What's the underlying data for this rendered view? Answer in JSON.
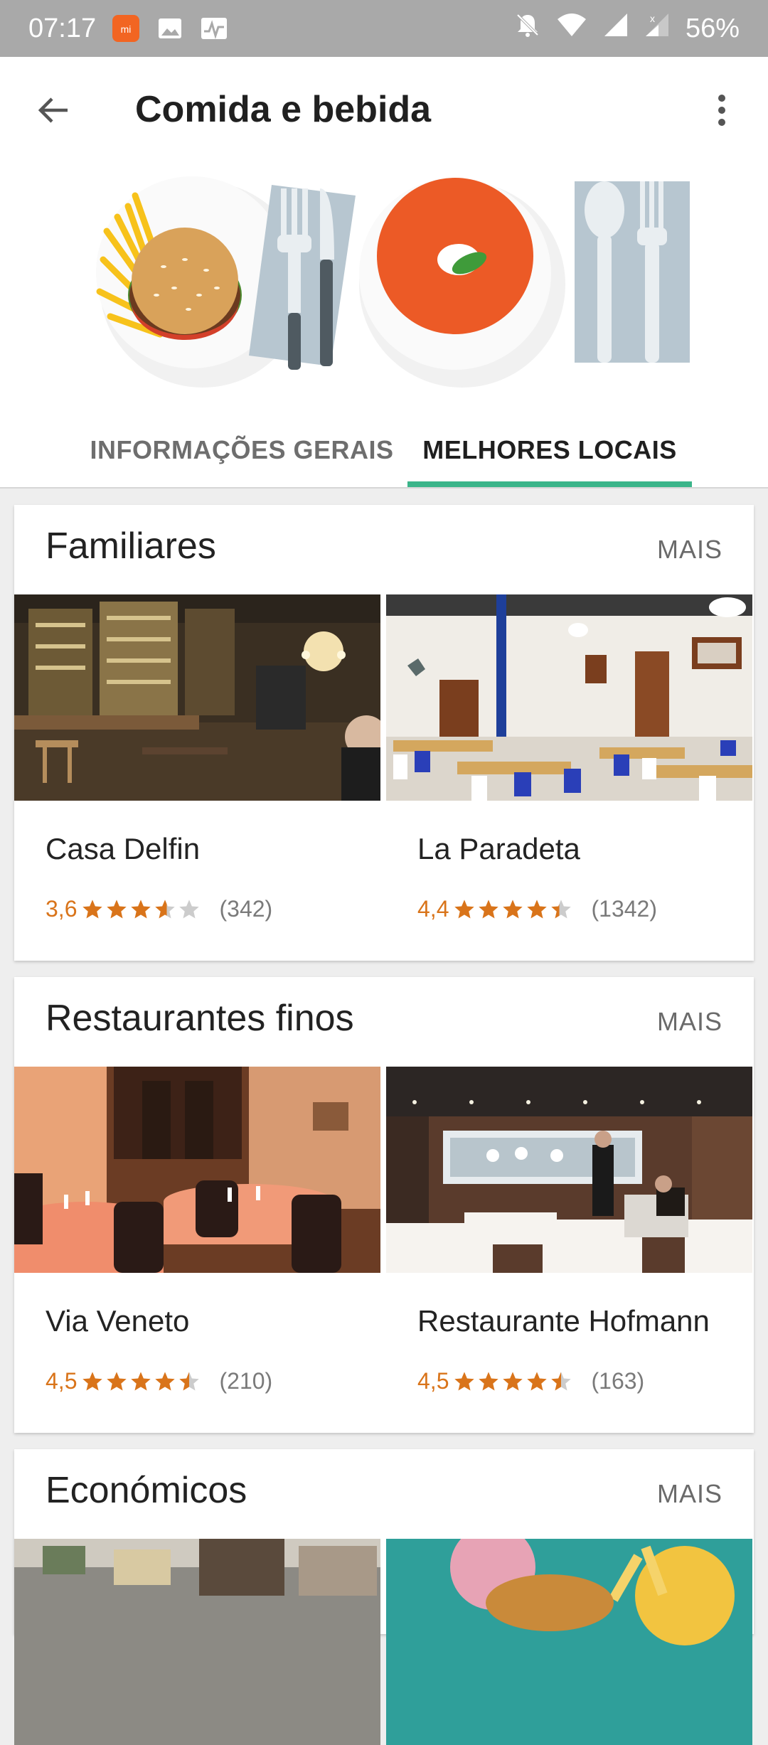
{
  "status_bar": {
    "time": "07:17",
    "battery": "56%",
    "icons": [
      "app-notification-icon",
      "image-icon",
      "activity-icon",
      "mute-icon",
      "wifi-icon",
      "signal-icon",
      "no-signal-icon"
    ]
  },
  "header": {
    "title": "Comida e bebida",
    "tabs": [
      {
        "label": "INFORMAÇÕES GERAIS",
        "selected": false
      },
      {
        "label": "MELHORES LOCAIS",
        "selected": true
      }
    ],
    "accent_color": "#3bb58a"
  },
  "sections": [
    {
      "title": "Familiares",
      "more": "MAIS",
      "places": [
        {
          "name": "Casa Delfin",
          "rating_text": "3,6",
          "rating": 3.6,
          "reviews": "(342)"
        },
        {
          "name": "La Paradeta",
          "rating_text": "4,4",
          "rating": 4.4,
          "reviews": "(1342)"
        }
      ]
    },
    {
      "title": "Restaurantes finos",
      "more": "MAIS",
      "places": [
        {
          "name": "Via Veneto",
          "rating_text": "4,5",
          "rating": 4.5,
          "reviews": "(210)"
        },
        {
          "name": "Restaurante Hofmann",
          "rating_text": "4,5",
          "rating": 4.5,
          "reviews": "(163)"
        }
      ]
    },
    {
      "title": "Económicos",
      "more": "MAIS",
      "places": []
    }
  ],
  "colors": {
    "rating": "#d9741a",
    "star_empty": "#cccccc"
  }
}
